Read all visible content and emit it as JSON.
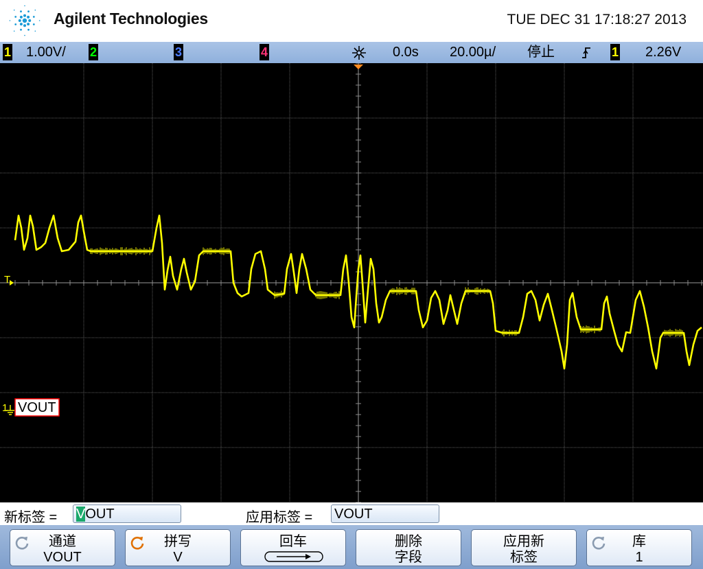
{
  "header": {
    "brand": "Agilent Technologies",
    "datetime": "TUE DEC 31 17:18:27 2013"
  },
  "statusbar": {
    "ch1_num": "1",
    "ch1_scale": "1.00V/",
    "ch2_num": "2",
    "ch3_num": "3",
    "ch4_num": "4",
    "time_delay": "0.0s",
    "time_scale": "20.00µ/",
    "run_state": "停止",
    "trigger_slope_icon": "rising-edge-icon",
    "trigger_source": "1",
    "trigger_level": "2.26V",
    "colors": {
      "ch1": "#ffff00",
      "ch2": "#00ff00",
      "ch3": "#4d7dff",
      "ch4": "#ff3377"
    }
  },
  "screen": {
    "trigger_marker": "T",
    "channel_ground_marker": "1",
    "channel_label": "VOUT",
    "trace_color": "#ffff00"
  },
  "labelrow": {
    "new_label_caption": "新标签 =",
    "new_label_first_char": "V",
    "new_label_rest": "OUT",
    "apply_label_caption": "应用标签 =",
    "apply_label_value": "VOUT"
  },
  "softkeys": [
    {
      "line1": "通道",
      "line2": "VOUT",
      "knob": true,
      "knob_active": false
    },
    {
      "line1": "拼写",
      "line2": "V",
      "knob": true,
      "knob_active": true
    },
    {
      "line1": "回车",
      "line2": "",
      "knob": false,
      "knob_active": false
    },
    {
      "line1": "删除",
      "line2": "字段",
      "knob": false,
      "knob_active": false
    },
    {
      "line1": "应用新",
      "line2": "标签",
      "knob": false,
      "knob_active": false
    },
    {
      "line1": "库",
      "line2": "1",
      "knob": true,
      "knob_active": false
    }
  ]
}
